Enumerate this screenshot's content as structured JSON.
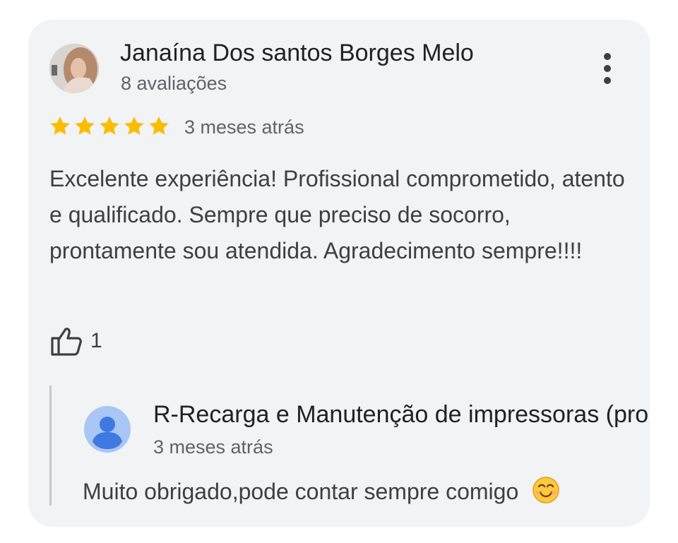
{
  "review": {
    "reviewer_name": "Janaína Dos santos Borges Melo",
    "review_count": "8 avaliações",
    "rating": 5,
    "date": "3 meses atrás",
    "text": "Excelente experiência! Profissional comprometido, atento e qualificado. Sempre que preciso de socorro, prontamente sou atendida. Agradecimento sempre!!!!",
    "likes": "1"
  },
  "owner_reply": {
    "name": "R-Recarga e Manutenção de impressoras (prop",
    "date": "3 meses atrás",
    "text": "Muito obrigado,pode contar sempre comigo"
  },
  "icons": {
    "more": "more-vert-icon",
    "star": "star-icon",
    "like": "thumbs-up-icon",
    "owner_avatar": "person-icon",
    "emoji": "smiling-face-emoji"
  },
  "colors": {
    "card_background": "#f1f3f4",
    "star": "#fbbc04",
    "owner_avatar": "#a9c6f5",
    "owner_avatar_icon": "#3f78e0"
  }
}
